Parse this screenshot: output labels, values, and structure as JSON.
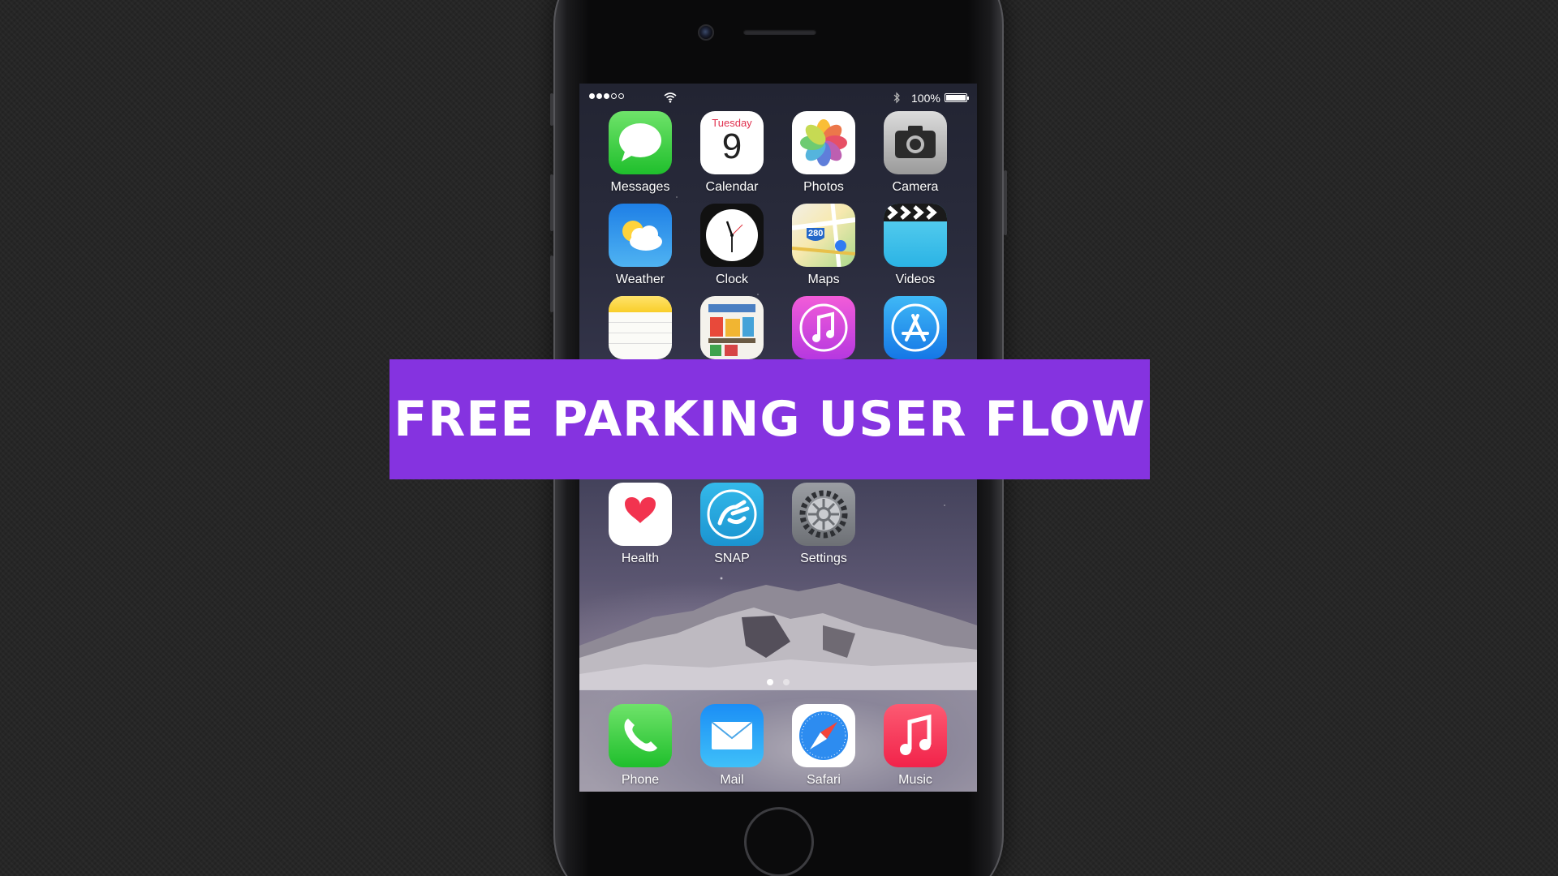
{
  "status_bar": {
    "battery": "100%"
  },
  "home_screen": {
    "apps": [
      {
        "id": "messages",
        "label": "Messages"
      },
      {
        "id": "calendar",
        "label": "Calendar",
        "weekday": "Tuesday",
        "day": "9"
      },
      {
        "id": "photos",
        "label": "Photos"
      },
      {
        "id": "camera",
        "label": "Camera"
      },
      {
        "id": "weather",
        "label": "Weather"
      },
      {
        "id": "clock",
        "label": "Clock"
      },
      {
        "id": "maps",
        "label": "Maps",
        "route": "280"
      },
      {
        "id": "videos",
        "label": "Videos"
      },
      {
        "id": "notes",
        "label": ""
      },
      {
        "id": "newsstand",
        "label": ""
      },
      {
        "id": "itunes-store",
        "label": ""
      },
      {
        "id": "app-store",
        "label": ""
      },
      {
        "id": "health",
        "label": "Health"
      },
      {
        "id": "snap",
        "label": "SNAP"
      },
      {
        "id": "settings",
        "label": "Settings"
      }
    ],
    "page_count": 2,
    "current_page": 1
  },
  "dock": {
    "apps": [
      {
        "id": "phone",
        "label": "Phone"
      },
      {
        "id": "mail",
        "label": "Mail"
      },
      {
        "id": "safari",
        "label": "Safari"
      },
      {
        "id": "music",
        "label": "Music"
      }
    ]
  },
  "banner": {
    "title": "FREE PARKING USER FLOW",
    "color": "#8533e0"
  }
}
